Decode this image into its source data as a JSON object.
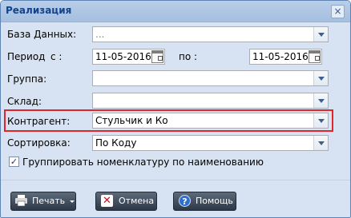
{
  "window": {
    "title": "Реализация",
    "close_icon": "×"
  },
  "form": {
    "database": {
      "label": "База Данных:",
      "placeholder": "..."
    },
    "period": {
      "label": "Период",
      "from_label": "с :",
      "from_value": "11-05-2016",
      "to_label": "по :",
      "to_value": "11-05-2016"
    },
    "group": {
      "label": "Группа:",
      "value": ""
    },
    "warehouse": {
      "label": "Склад:",
      "value": ""
    },
    "counterparty": {
      "label": "Контрагент:",
      "value": "Стульчик и Ко"
    },
    "sort": {
      "label": "Сортировка:",
      "value": "По Коду"
    },
    "group_checkbox": {
      "label": "Группировать номенклатуру по наименованию",
      "checked": true,
      "mark": "✓"
    }
  },
  "buttons": {
    "print": "Печать",
    "cancel": "Отмена",
    "cancel_icon": "✕",
    "help": "Помощь",
    "help_icon": "?"
  },
  "colors": {
    "highlight": "#e0252b",
    "title": "#15428b",
    "panel": "#d7e3f2"
  }
}
